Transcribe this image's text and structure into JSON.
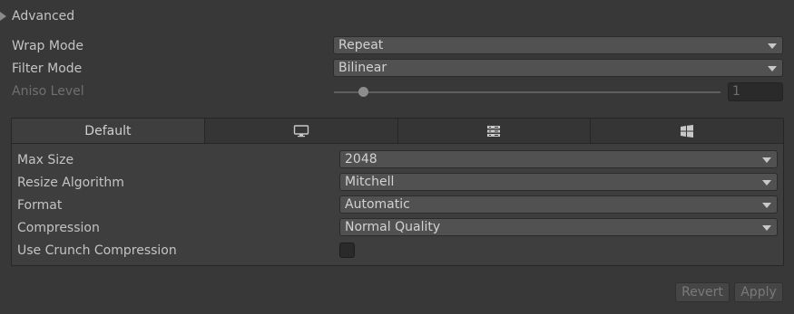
{
  "section": {
    "title": "Advanced"
  },
  "wrap_mode": {
    "label": "Wrap Mode",
    "value": "Repeat"
  },
  "filter_mode": {
    "label": "Filter Mode",
    "value": "Bilinear"
  },
  "aniso_level": {
    "label": "Aniso Level",
    "value": "1",
    "slider_min": 0,
    "slider_max": 16,
    "slider_value": 1
  },
  "platform_tabs": [
    {
      "label": "Default",
      "icon": null,
      "active": true
    },
    {
      "label": "",
      "icon": "monitor-icon",
      "active": false
    },
    {
      "label": "",
      "icon": "server-icon",
      "active": false
    },
    {
      "label": "",
      "icon": "windows-icon",
      "active": false
    }
  ],
  "platform_settings": {
    "max_size": {
      "label": "Max Size",
      "value": "2048"
    },
    "resize_algorithm": {
      "label": "Resize Algorithm",
      "value": "Mitchell"
    },
    "format": {
      "label": "Format",
      "value": "Automatic"
    },
    "compression": {
      "label": "Compression",
      "value": "Normal Quality"
    },
    "crunch": {
      "label": "Use Crunch Compression",
      "checked": false
    }
  },
  "buttons": {
    "revert": "Revert",
    "apply": "Apply"
  }
}
